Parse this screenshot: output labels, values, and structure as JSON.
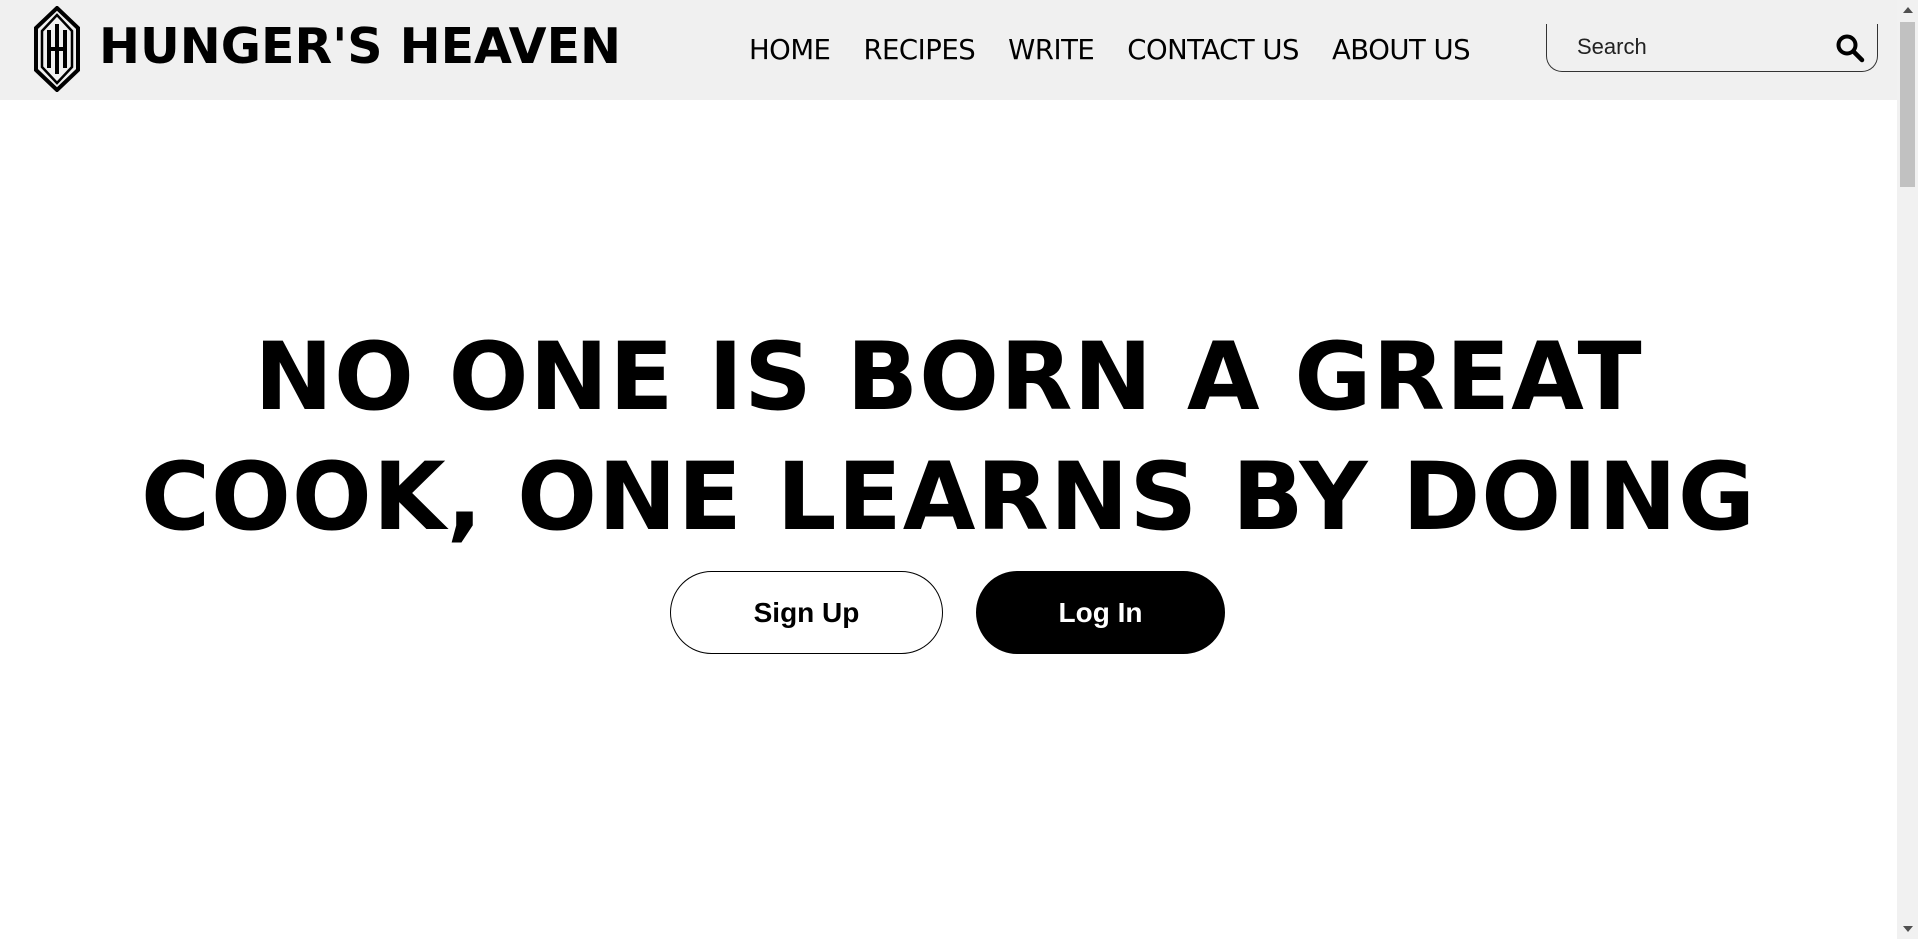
{
  "brand": {
    "name": "HUNGER'S HEAVEN",
    "logo_icon": "hh-monogram-hexagon-icon"
  },
  "nav": {
    "items": [
      {
        "label": "HOME"
      },
      {
        "label": "RECIPES"
      },
      {
        "label": "WRITE"
      },
      {
        "label": "CONTACT US"
      },
      {
        "label": "ABOUT US"
      }
    ]
  },
  "search": {
    "placeholder": "Search",
    "value": "",
    "icon": "search-icon"
  },
  "hero": {
    "line1": "NO ONE IS BORN A GREAT",
    "line2": "COOK, ONE LEARNS BY DOING",
    "signup_label": "Sign Up",
    "login_label": "Log In"
  },
  "colors": {
    "header_bg": "#f0f0f0",
    "page_bg": "#ffffff",
    "text": "#000000",
    "primary_button_bg": "#000000",
    "primary_button_text": "#ffffff"
  }
}
